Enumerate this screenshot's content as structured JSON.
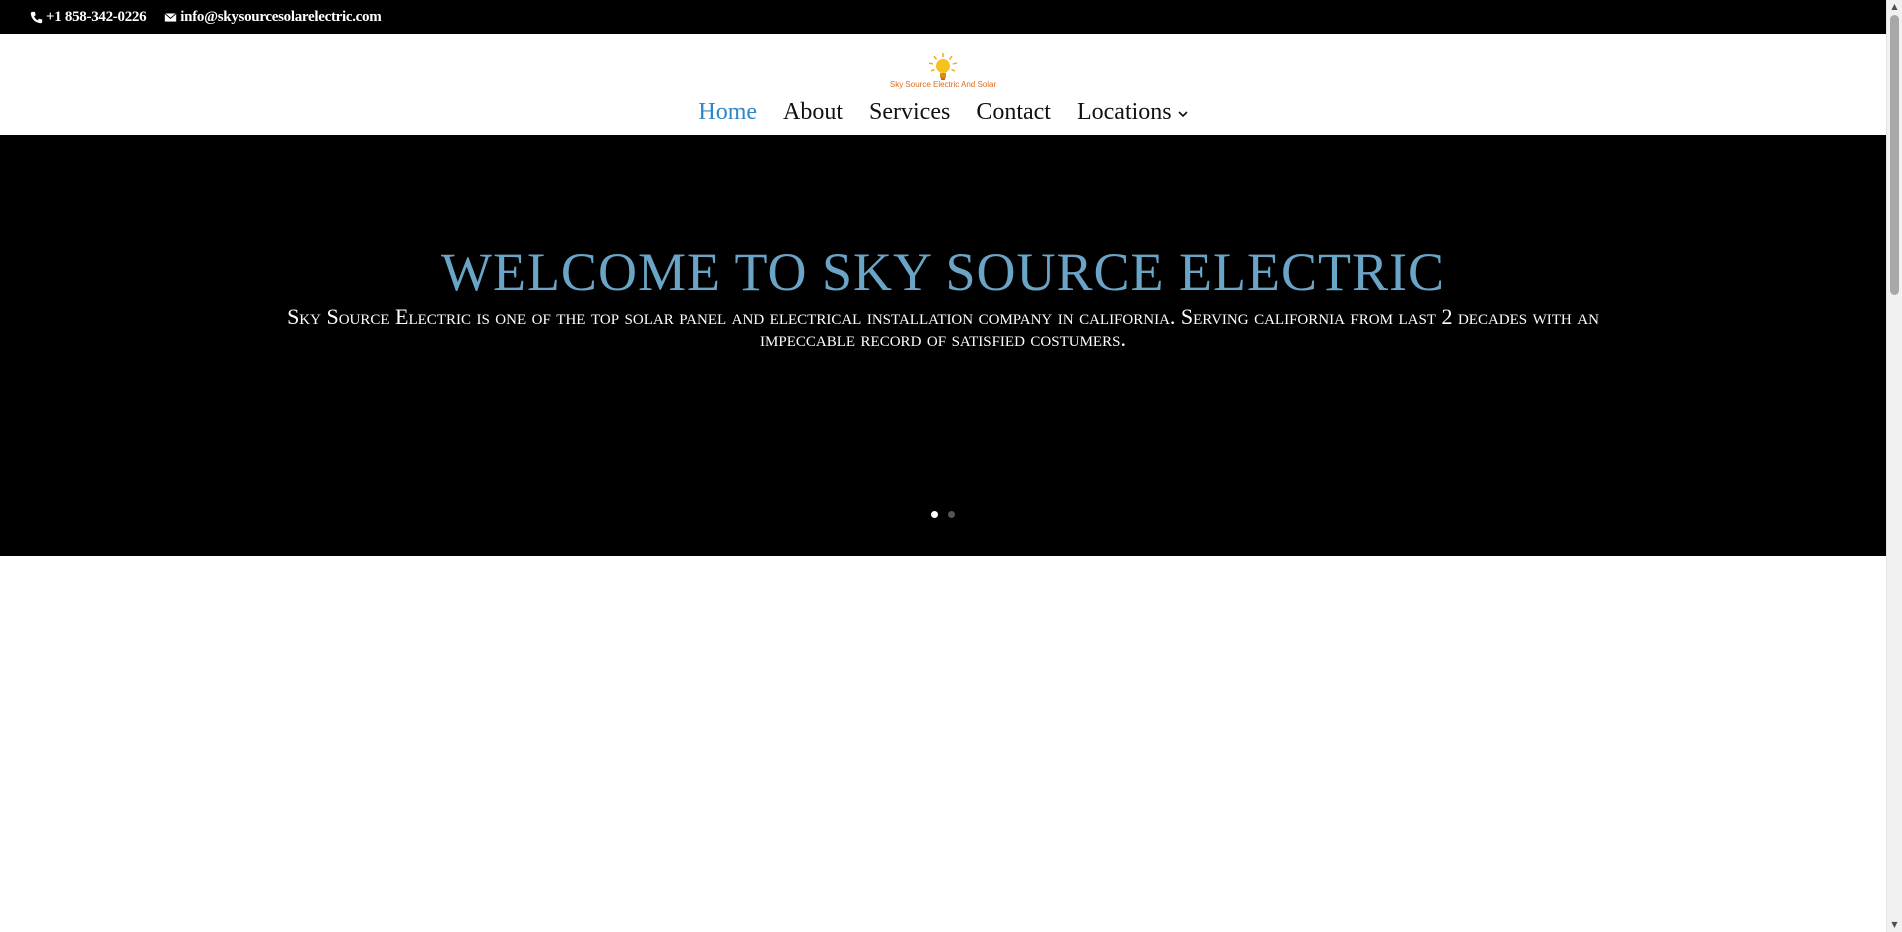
{
  "topbar": {
    "phone": "+1 858-342-0226",
    "email": "info@skysourcesolarelectric.com",
    "phone_icon": "phone-icon",
    "email_icon": "envelope-icon"
  },
  "logo": {
    "text": "Sky Source Electric And Solar",
    "icon": "lightbulb-sun-icon"
  },
  "nav": {
    "items": [
      {
        "label": "Home",
        "active": true
      },
      {
        "label": "About"
      },
      {
        "label": "Services"
      },
      {
        "label": "Contact"
      },
      {
        "label": "Locations",
        "has_submenu": true
      }
    ]
  },
  "hero": {
    "title": "WELCOME TO SKY SOURCE ELECTRIC",
    "subtitle": "Sky Source Electric is one of the top solar panel and electrical installation company in california. Serving california from last 2 decades with an impeccable record of satisfied costumers.",
    "slides": 2,
    "active_slide": 1
  },
  "colors": {
    "accent": "#2b87c6",
    "hero_title": "#6aa4c6",
    "topbar_bg": "#000000",
    "hero_bg": "#000000"
  }
}
